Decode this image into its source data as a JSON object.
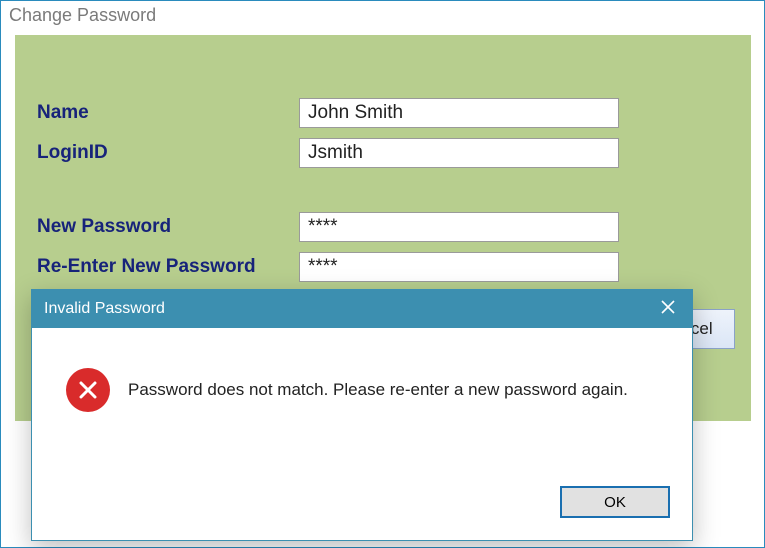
{
  "window": {
    "title": "Change Password"
  },
  "form": {
    "name_label": "Name",
    "name_value": "John Smith",
    "login_label": "LoginID",
    "login_value": "Jsmith",
    "newpw_label": "New Password",
    "newpw_value": "****",
    "repw_label": "Re-Enter New Password",
    "repw_value": "****",
    "cancel_label": "ncel"
  },
  "dialog": {
    "title": "Invalid Password",
    "message": "Password does not match. Please re-enter a new password again.",
    "ok_label": "OK"
  }
}
